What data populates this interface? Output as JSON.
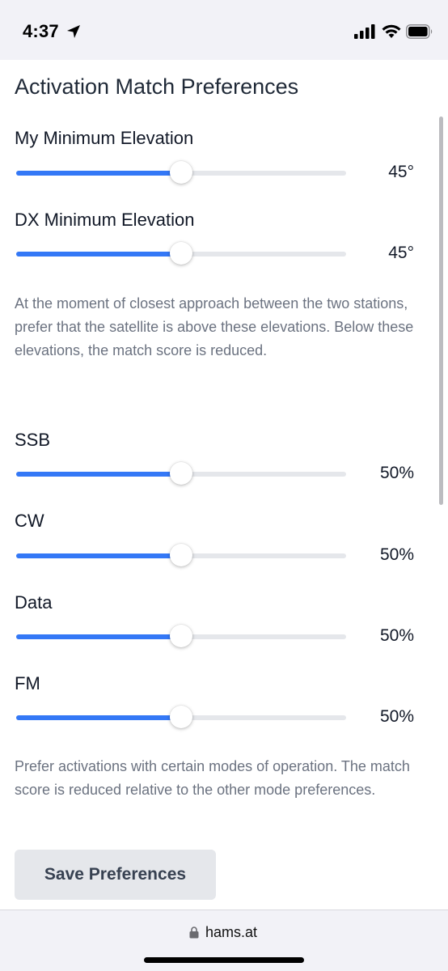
{
  "status_bar": {
    "time": "4:37",
    "icons": [
      "location-arrow-icon",
      "cellular-signal-icon",
      "wifi-icon",
      "battery-icon"
    ]
  },
  "page": {
    "title": "Activation Match Preferences"
  },
  "elevation": {
    "my_min": {
      "label": "My Minimum Elevation",
      "value_text": "45°",
      "value": 45,
      "fraction": 0.5
    },
    "dx_min": {
      "label": "DX Minimum Elevation",
      "value_text": "45°",
      "value": 45,
      "fraction": 0.5
    },
    "help": "At the moment of closest approach between the two stations, prefer that the satellite is above these elevations. Below these elevations, the match score is reduced."
  },
  "modes": {
    "ssb": {
      "label": "SSB",
      "value_text": "50%",
      "fraction": 0.5
    },
    "cw": {
      "label": "CW",
      "value_text": "50%",
      "fraction": 0.5
    },
    "data": {
      "label": "Data",
      "value_text": "50%",
      "fraction": 0.5
    },
    "fm": {
      "label": "FM",
      "value_text": "50%",
      "fraction": 0.5
    },
    "help": "Prefer activations with certain modes of operation. The match score is reduced relative to the other mode preferences."
  },
  "actions": {
    "save_label": "Save Preferences"
  },
  "browser": {
    "url": "hams.at"
  },
  "colors": {
    "accent": "#3478f6",
    "track": "#e5e7eb",
    "help_text": "#6b7280",
    "button_bg": "#e5e7eb"
  }
}
